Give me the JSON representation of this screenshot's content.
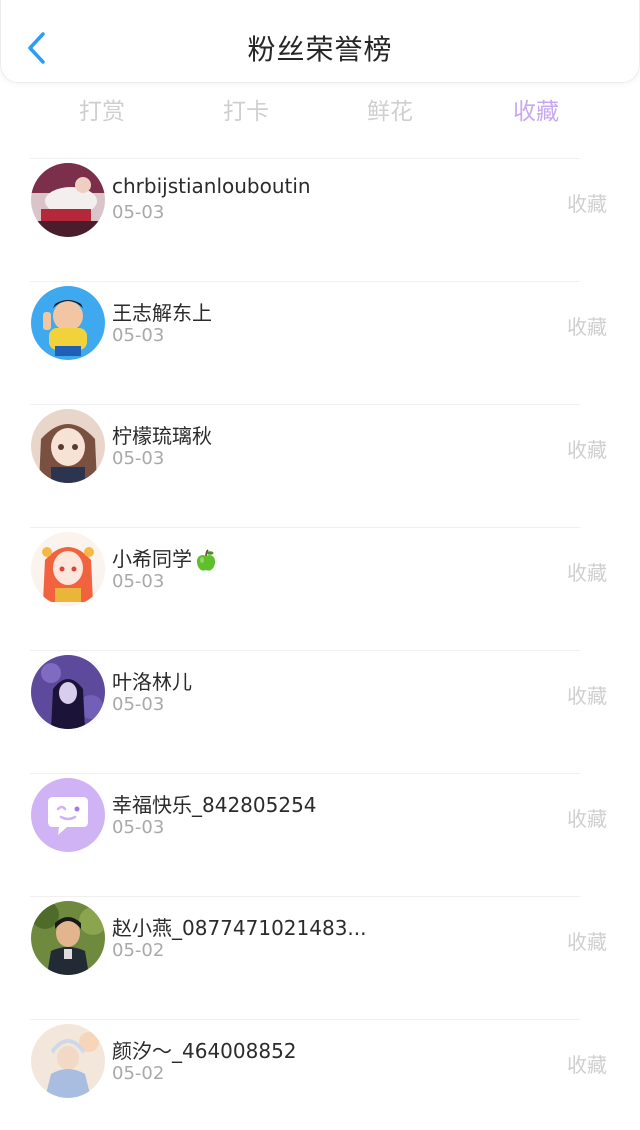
{
  "header": {
    "title": "粉丝荣誉榜",
    "back_icon": "chevron-left-icon",
    "accent_color": "#2a9df4"
  },
  "tabs": [
    {
      "label": "打赏",
      "active": false
    },
    {
      "label": "打卡",
      "active": false
    },
    {
      "label": "鲜花",
      "active": false
    },
    {
      "label": "收藏",
      "active": true
    }
  ],
  "tab_active_color": "#c8a8f0",
  "fans": [
    {
      "name": "chrbijstianlouboutin",
      "date": "05-03",
      "action": "收藏"
    },
    {
      "name": "王志解东上",
      "date": "05-03",
      "action": "收藏"
    },
    {
      "name": "柠檬琉璃秋",
      "date": "05-03",
      "action": "收藏"
    },
    {
      "name": "小希同学",
      "date": "05-03",
      "action": "收藏",
      "emoji": "green-apple-icon"
    },
    {
      "name": "叶洛林儿",
      "date": "05-03",
      "action": "收藏"
    },
    {
      "name": "幸福快乐_842805254",
      "date": "05-03",
      "action": "收藏"
    },
    {
      "name": "赵小燕_0877471021483...",
      "date": "05-02",
      "action": "收藏"
    },
    {
      "name": "颜汐～_464008852",
      "date": "05-02",
      "action": "收藏"
    }
  ]
}
